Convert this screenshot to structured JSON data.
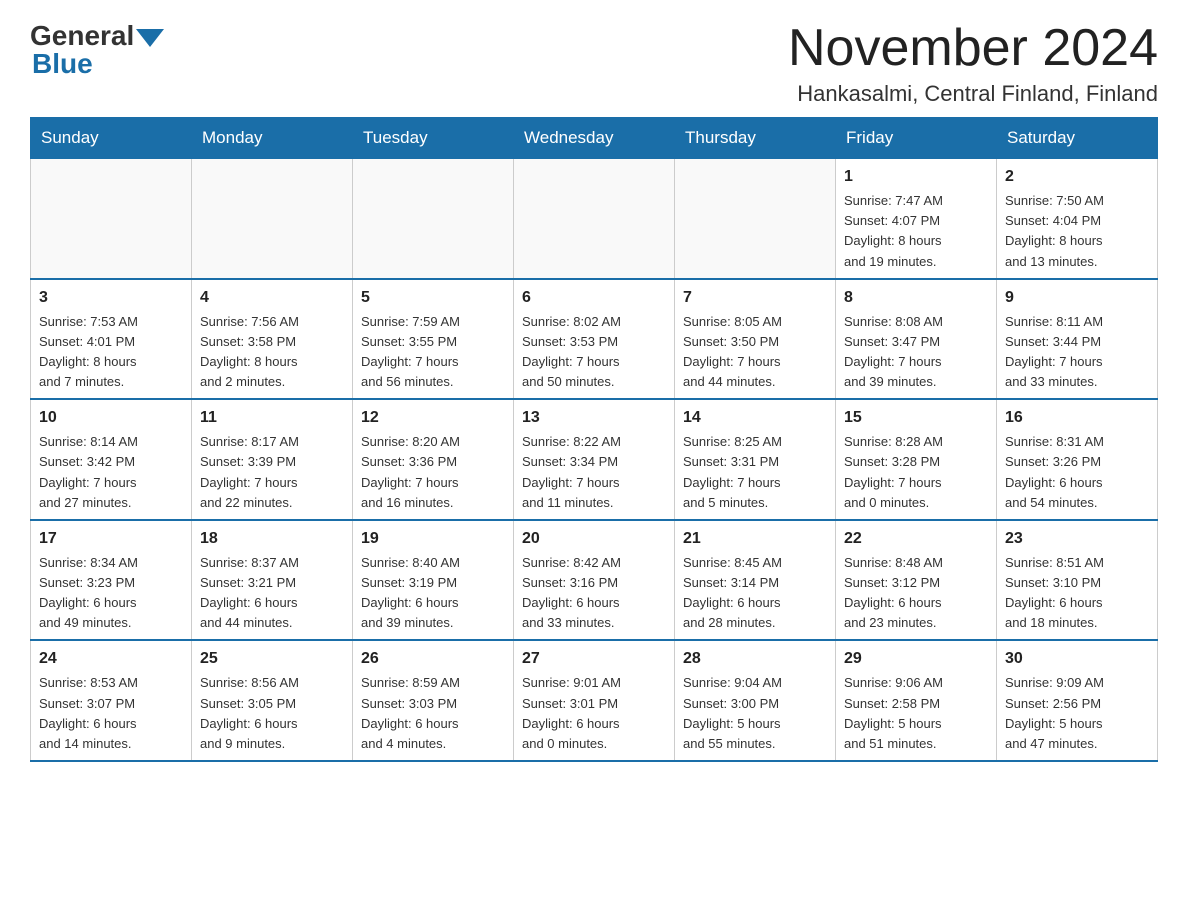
{
  "logo": {
    "general": "General",
    "blue": "Blue"
  },
  "title": "November 2024",
  "location": "Hankasalmi, Central Finland, Finland",
  "days_of_week": [
    "Sunday",
    "Monday",
    "Tuesday",
    "Wednesday",
    "Thursday",
    "Friday",
    "Saturday"
  ],
  "weeks": [
    [
      {
        "day": "",
        "info": ""
      },
      {
        "day": "",
        "info": ""
      },
      {
        "day": "",
        "info": ""
      },
      {
        "day": "",
        "info": ""
      },
      {
        "day": "",
        "info": ""
      },
      {
        "day": "1",
        "info": "Sunrise: 7:47 AM\nSunset: 4:07 PM\nDaylight: 8 hours\nand 19 minutes."
      },
      {
        "day": "2",
        "info": "Sunrise: 7:50 AM\nSunset: 4:04 PM\nDaylight: 8 hours\nand 13 minutes."
      }
    ],
    [
      {
        "day": "3",
        "info": "Sunrise: 7:53 AM\nSunset: 4:01 PM\nDaylight: 8 hours\nand 7 minutes."
      },
      {
        "day": "4",
        "info": "Sunrise: 7:56 AM\nSunset: 3:58 PM\nDaylight: 8 hours\nand 2 minutes."
      },
      {
        "day": "5",
        "info": "Sunrise: 7:59 AM\nSunset: 3:55 PM\nDaylight: 7 hours\nand 56 minutes."
      },
      {
        "day": "6",
        "info": "Sunrise: 8:02 AM\nSunset: 3:53 PM\nDaylight: 7 hours\nand 50 minutes."
      },
      {
        "day": "7",
        "info": "Sunrise: 8:05 AM\nSunset: 3:50 PM\nDaylight: 7 hours\nand 44 minutes."
      },
      {
        "day": "8",
        "info": "Sunrise: 8:08 AM\nSunset: 3:47 PM\nDaylight: 7 hours\nand 39 minutes."
      },
      {
        "day": "9",
        "info": "Sunrise: 8:11 AM\nSunset: 3:44 PM\nDaylight: 7 hours\nand 33 minutes."
      }
    ],
    [
      {
        "day": "10",
        "info": "Sunrise: 8:14 AM\nSunset: 3:42 PM\nDaylight: 7 hours\nand 27 minutes."
      },
      {
        "day": "11",
        "info": "Sunrise: 8:17 AM\nSunset: 3:39 PM\nDaylight: 7 hours\nand 22 minutes."
      },
      {
        "day": "12",
        "info": "Sunrise: 8:20 AM\nSunset: 3:36 PM\nDaylight: 7 hours\nand 16 minutes."
      },
      {
        "day": "13",
        "info": "Sunrise: 8:22 AM\nSunset: 3:34 PM\nDaylight: 7 hours\nand 11 minutes."
      },
      {
        "day": "14",
        "info": "Sunrise: 8:25 AM\nSunset: 3:31 PM\nDaylight: 7 hours\nand 5 minutes."
      },
      {
        "day": "15",
        "info": "Sunrise: 8:28 AM\nSunset: 3:28 PM\nDaylight: 7 hours\nand 0 minutes."
      },
      {
        "day": "16",
        "info": "Sunrise: 8:31 AM\nSunset: 3:26 PM\nDaylight: 6 hours\nand 54 minutes."
      }
    ],
    [
      {
        "day": "17",
        "info": "Sunrise: 8:34 AM\nSunset: 3:23 PM\nDaylight: 6 hours\nand 49 minutes."
      },
      {
        "day": "18",
        "info": "Sunrise: 8:37 AM\nSunset: 3:21 PM\nDaylight: 6 hours\nand 44 minutes."
      },
      {
        "day": "19",
        "info": "Sunrise: 8:40 AM\nSunset: 3:19 PM\nDaylight: 6 hours\nand 39 minutes."
      },
      {
        "day": "20",
        "info": "Sunrise: 8:42 AM\nSunset: 3:16 PM\nDaylight: 6 hours\nand 33 minutes."
      },
      {
        "day": "21",
        "info": "Sunrise: 8:45 AM\nSunset: 3:14 PM\nDaylight: 6 hours\nand 28 minutes."
      },
      {
        "day": "22",
        "info": "Sunrise: 8:48 AM\nSunset: 3:12 PM\nDaylight: 6 hours\nand 23 minutes."
      },
      {
        "day": "23",
        "info": "Sunrise: 8:51 AM\nSunset: 3:10 PM\nDaylight: 6 hours\nand 18 minutes."
      }
    ],
    [
      {
        "day": "24",
        "info": "Sunrise: 8:53 AM\nSunset: 3:07 PM\nDaylight: 6 hours\nand 14 minutes."
      },
      {
        "day": "25",
        "info": "Sunrise: 8:56 AM\nSunset: 3:05 PM\nDaylight: 6 hours\nand 9 minutes."
      },
      {
        "day": "26",
        "info": "Sunrise: 8:59 AM\nSunset: 3:03 PM\nDaylight: 6 hours\nand 4 minutes."
      },
      {
        "day": "27",
        "info": "Sunrise: 9:01 AM\nSunset: 3:01 PM\nDaylight: 6 hours\nand 0 minutes."
      },
      {
        "day": "28",
        "info": "Sunrise: 9:04 AM\nSunset: 3:00 PM\nDaylight: 5 hours\nand 55 minutes."
      },
      {
        "day": "29",
        "info": "Sunrise: 9:06 AM\nSunset: 2:58 PM\nDaylight: 5 hours\nand 51 minutes."
      },
      {
        "day": "30",
        "info": "Sunrise: 9:09 AM\nSunset: 2:56 PM\nDaylight: 5 hours\nand 47 minutes."
      }
    ]
  ]
}
